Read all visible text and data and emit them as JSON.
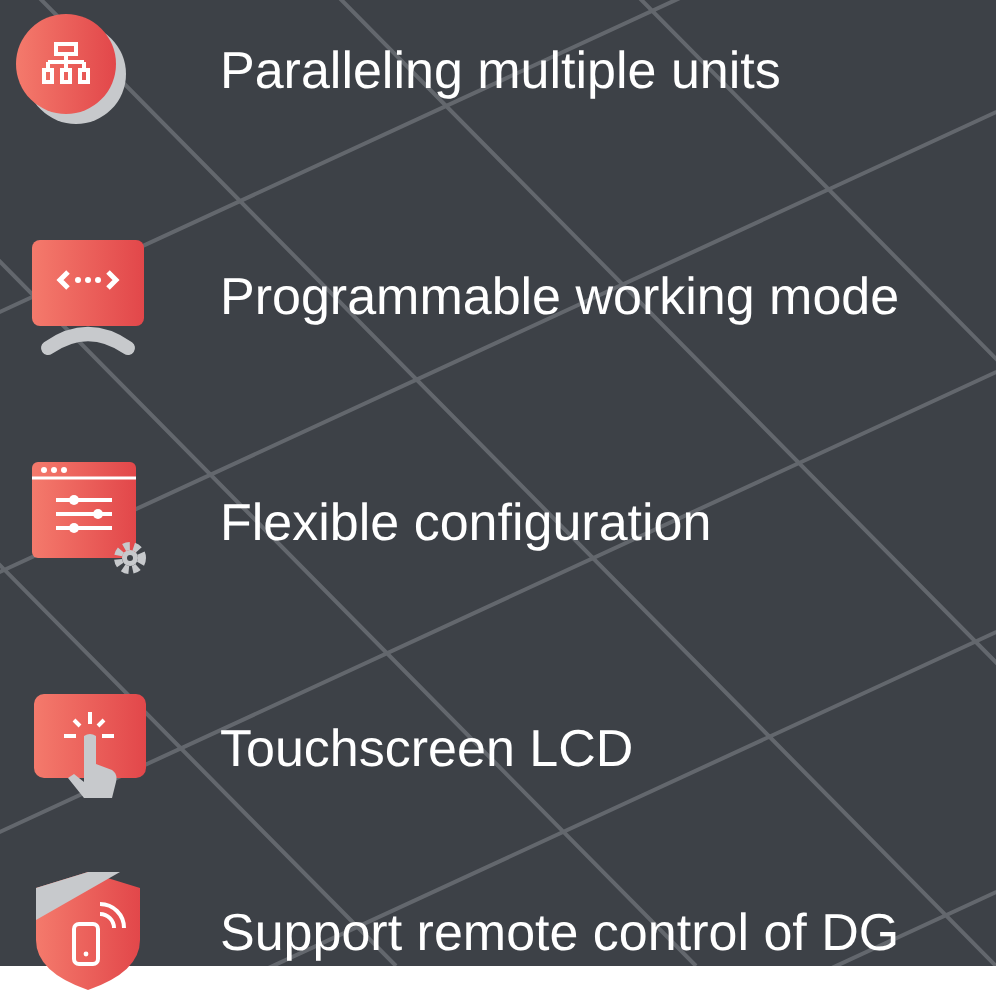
{
  "features": [
    {
      "kind": "network",
      "label": "Paralleling multiple units"
    },
    {
      "kind": "code",
      "label": "Programmable working mode"
    },
    {
      "kind": "settings",
      "label": "Flexible configuration"
    },
    {
      "kind": "touch",
      "label": "Touchscreen LCD"
    },
    {
      "kind": "remote",
      "label": "Support remote control of DG"
    }
  ]
}
